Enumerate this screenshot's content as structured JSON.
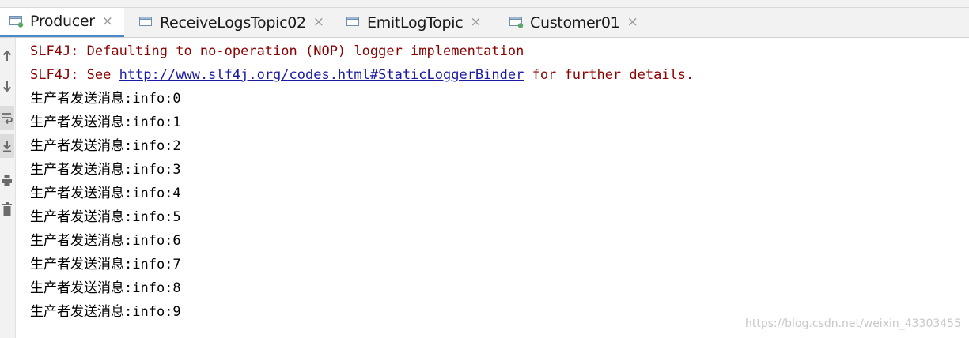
{
  "tabs": [
    {
      "label": "Producer",
      "close": "×",
      "active": true,
      "icon": "run-console-icon"
    },
    {
      "label": "ReceiveLogsTopic02",
      "close": "×",
      "active": false,
      "icon": "run-console-icon"
    },
    {
      "label": "EmitLogTopic",
      "close": "×",
      "active": false,
      "icon": "run-console-icon"
    },
    {
      "label": "Customer01",
      "close": "×",
      "active": false,
      "icon": "run-console-icon"
    }
  ],
  "toolbar": [
    {
      "name": "scroll-up-icon"
    },
    {
      "name": "scroll-down-icon"
    },
    {
      "name": "soft-wrap-icon"
    },
    {
      "name": "scroll-to-end-icon"
    },
    {
      "name": "print-icon"
    },
    {
      "name": "clear-all-icon"
    }
  ],
  "console": {
    "slf4j_line1": "SLF4J: Defaulting to no-operation (NOP) logger implementation",
    "slf4j_line2_prefix": "SLF4J: See ",
    "slf4j_line2_link": "http://www.slf4j.org/codes.html#StaticLoggerBinder",
    "slf4j_line2_suffix": " for further details.",
    "messages": [
      "生产者发送消息:info:0",
      "生产者发送消息:info:1",
      "生产者发送消息:info:2",
      "生产者发送消息:info:3",
      "生产者发送消息:info:4",
      "生产者发送消息:info:5",
      "生产者发送消息:info:6",
      "生产者发送消息:info:7",
      "生产者发送消息:info:8",
      "生产者发送消息:info:9"
    ]
  },
  "watermark": "https://blog.csdn.net/weixin_43303455",
  "colors": {
    "error_text": "#8b0000",
    "link": "#1a1aa6",
    "active_tab_underline": "#4a88c7",
    "run_badge": "#59a869"
  }
}
